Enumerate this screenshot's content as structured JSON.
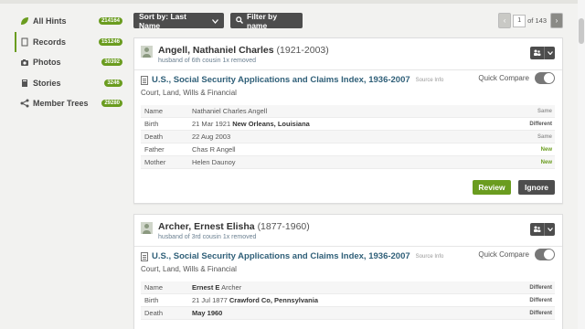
{
  "sidebar": {
    "items": [
      {
        "label": "All Hints",
        "count": "214164",
        "icon": "leaf-icon"
      },
      {
        "label": "Records",
        "count": "151246",
        "icon": "document-icon"
      },
      {
        "label": "Photos",
        "count": "30392",
        "icon": "camera-icon"
      },
      {
        "label": "Stories",
        "count": "3246",
        "icon": "book-icon"
      },
      {
        "label": "Member Trees",
        "count": "29280",
        "icon": "tree-icon"
      }
    ]
  },
  "toolbar": {
    "sort_label": "Sort by: Last Name",
    "filter_label": "Filter by name",
    "page_current": "1",
    "page_of": "of 143"
  },
  "hints": [
    {
      "name": "Angell, Nathaniel Charles",
      "years": "(1921-2003)",
      "relation": "husband of 6th cousin 1x removed",
      "record_title": "U.S., Social Security Applications and Claims Index, 1936-2007",
      "source_info": "Source Info",
      "category": "Court, Land, Wills & Financial",
      "quick_compare": "Quick Compare",
      "facts": [
        {
          "label": "Name",
          "value": "Nathaniel Charles Angell",
          "bold": "",
          "status": "Same"
        },
        {
          "label": "Birth",
          "value": "21 Mar 1921",
          "bold": "New Orleans, Louisiana",
          "status": "Different"
        },
        {
          "label": "Death",
          "value": "22 Aug 2003",
          "bold": "",
          "status": "Same"
        },
        {
          "label": "Father",
          "value": "Chas R Angell",
          "bold": "",
          "status": "New"
        },
        {
          "label": "Mother",
          "value": "Helen Daunoy",
          "bold": "",
          "status": "New"
        }
      ],
      "review_label": "Review",
      "ignore_label": "Ignore"
    },
    {
      "name": "Archer, Ernest Elisha",
      "years": "(1877-1960)",
      "relation": "husband of 3rd cousin 1x removed",
      "record_title": "U.S., Social Security Applications and Claims Index, 1936-2007",
      "source_info": "Source Info",
      "category": "Court, Land, Wills & Financial",
      "quick_compare": "Quick Compare",
      "facts": [
        {
          "label": "Name",
          "value": "Archer",
          "bold": "Ernest E",
          "status": "Different"
        },
        {
          "label": "Birth",
          "value": "21 Jul 1877",
          "bold": "Crawford Co, Pennsylvania",
          "status": "Different"
        },
        {
          "label": "Death",
          "value": "",
          "bold": "May 1960",
          "status": "Different"
        }
      ]
    }
  ]
}
